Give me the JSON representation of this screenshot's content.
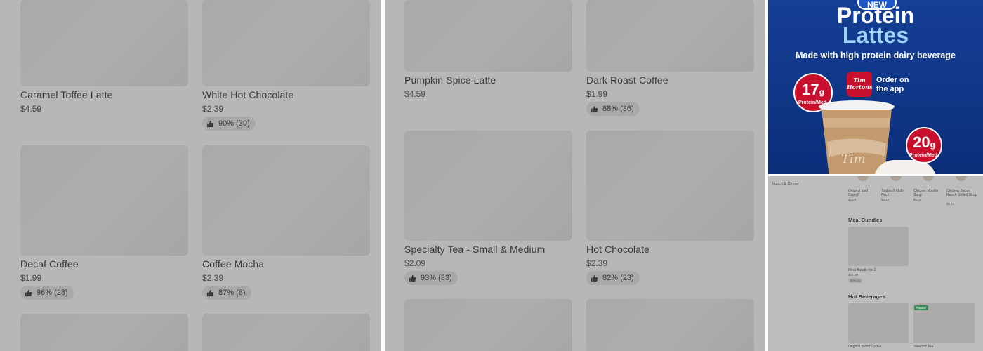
{
  "panel_a": {
    "items": [
      {
        "name": "",
        "price": "",
        "rating": ""
      },
      {
        "name": "",
        "price": "",
        "rating": ""
      },
      {
        "name": "Caramel Toffee Latte",
        "price": "$4.59",
        "rating": ""
      },
      {
        "name": "White Hot Chocolate",
        "price": "$2.39",
        "rating": "90% (30)"
      },
      {
        "name": "Decaf Coffee",
        "price": "$1.99",
        "rating": "96% (28)"
      },
      {
        "name": "Coffee Mocha",
        "price": "$2.39",
        "rating": "87% (8)"
      }
    ]
  },
  "panel_b": {
    "items": [
      {
        "name": "Pumpkin Spice Latte",
        "price": "$4.59",
        "rating": ""
      },
      {
        "name": "Dark Roast Coffee",
        "price": "$1.99",
        "rating": "88% (36)"
      },
      {
        "name": "Specialty Tea - Small & Medium",
        "price": "$2.09",
        "rating": "93% (33)"
      },
      {
        "name": "Hot Chocolate",
        "price": "$2.39",
        "rating": "82% (23)"
      }
    ]
  },
  "promo": {
    "new_label": "NEW",
    "title_line1": "Protein",
    "title_line2": "Lattes",
    "subtitle": "Made with high protein dairy beverage",
    "badge_left_value": "17",
    "badge_left_unit": "g",
    "badge_left_label": "Protein/Med.",
    "badge_right_value": "20",
    "badge_right_unit": "g",
    "badge_right_label": "Protein/Med.",
    "logo_text_line1": "Tim",
    "logo_text_line2": "Hortons",
    "order_line1": "Order on",
    "order_line2": "the app",
    "colors": {
      "background": "#153f96",
      "accent_red": "#c8102e",
      "title_light": "#9fd3ff"
    }
  },
  "mini_app": {
    "sidebar_item": "Lunch & Dinner",
    "top_row": [
      {
        "name": "Original Iced Capp®",
        "price": "$3.59"
      },
      {
        "name": "Timbits® Multi-Pack",
        "price": "$3.39"
      },
      {
        "name": "Chicken Noodle Soup",
        "price": "$5.09"
      },
      {
        "name": "Chicken Bacon Ranch Grilled Wrap",
        "price": "$6.19"
      }
    ],
    "meal_bundles": {
      "heading": "Meal Bundles",
      "item": {
        "name": "Meal Bundle for 2",
        "price": "$21.59",
        "rating": "80% (5)"
      }
    },
    "hot_beverages": {
      "heading": "Hot Beverages",
      "tag": "Popular",
      "items": [
        {
          "name": "Original Blend Coffee"
        },
        {
          "name": "Steeped Tea"
        }
      ]
    }
  }
}
